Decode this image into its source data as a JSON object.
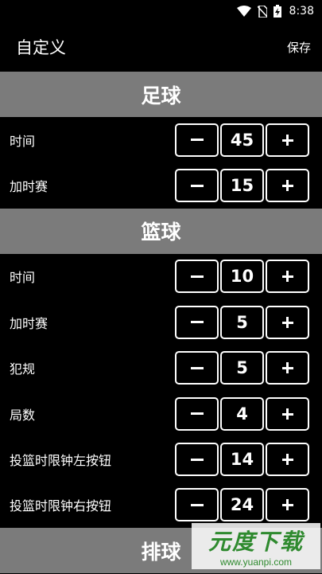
{
  "status_bar": {
    "time": "8:38",
    "icons": [
      "wifi-icon",
      "no-sim-icon",
      "battery-charging-icon"
    ]
  },
  "app_bar": {
    "title": "自定义",
    "save_label": "保存"
  },
  "sections": [
    {
      "title": "足球",
      "rows": [
        {
          "label": "时间",
          "value": "45"
        },
        {
          "label": "加时赛",
          "value": "15"
        }
      ]
    },
    {
      "title": "篮球",
      "rows": [
        {
          "label": "时间",
          "value": "10"
        },
        {
          "label": "加时赛",
          "value": "5"
        },
        {
          "label": "犯规",
          "value": "5"
        },
        {
          "label": "局数",
          "value": "4"
        },
        {
          "label": "投篮时限钟左按钮",
          "value": "14"
        },
        {
          "label": "投篮时限钟右按钮",
          "value": "24"
        }
      ]
    },
    {
      "title": "排球",
      "rows": []
    }
  ],
  "watermark": {
    "main": "元度下载",
    "sub": "www.yuanpi.com"
  }
}
